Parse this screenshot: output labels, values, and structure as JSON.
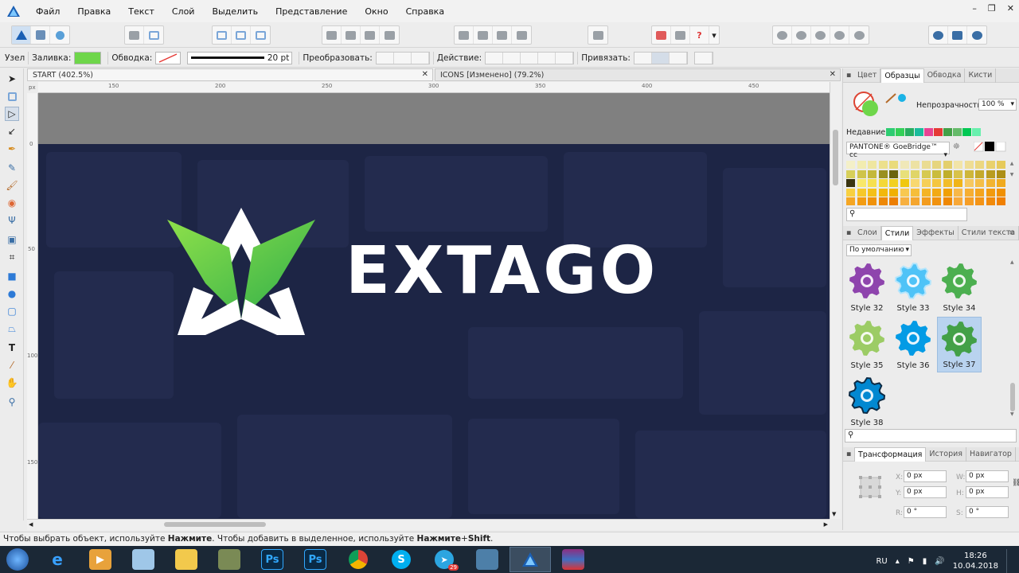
{
  "menu": {
    "items": [
      "Файл",
      "Правка",
      "Текст",
      "Слой",
      "Выделить",
      "Представление",
      "Окно",
      "Справка"
    ]
  },
  "context_bar": {
    "mode_label": "Узел",
    "fill_label": "Заливка:",
    "fill_color": "#6ed64a",
    "stroke_label": "Обводка:",
    "stroke_width": "20 pt",
    "transform_label": "Преобразовать:",
    "action_label": "Действие:",
    "snap_label": "Привязать:"
  },
  "tabs": [
    {
      "label": "START (402.5%)"
    },
    {
      "label": "ICONS [Изменено] (79.2%)"
    }
  ],
  "ruler": {
    "h_ticks": [
      "150",
      "200",
      "250",
      "300",
      "350",
      "400",
      "450"
    ],
    "v_ticks": [
      "0",
      "50",
      "100",
      "150"
    ],
    "unit": "px"
  },
  "canvas": {
    "brand_text": "EXTAGO",
    "background": "#1d2545"
  },
  "panel_top": {
    "tabs": [
      "Цвет",
      "Образцы",
      "Обводка",
      "Кисти"
    ],
    "active_tab": "Образцы",
    "opacity_label": "Непрозрачность:",
    "opacity_value": "100 %",
    "recent_label": "Недавние:",
    "recent_colors": [
      "#2ecc71",
      "#34d058",
      "#27ae60",
      "#1abc9c",
      "#e84393",
      "#e53935",
      "#43a047",
      "#66bb6a",
      "#00c853",
      "#69f0ae"
    ],
    "palette_name": "PANTONE® GoeBridge™ cc"
  },
  "panel_styles": {
    "tabs": [
      "Слои",
      "Стили",
      "Эффекты",
      "Стили текста"
    ],
    "active_tab": "Стили",
    "category": "По умолчанию",
    "items": [
      {
        "label": "Style 32",
        "color": "#8e44ad"
      },
      {
        "label": "Style 33",
        "color": "#4fc3f7"
      },
      {
        "label": "Style 34",
        "color": "#4caf50"
      },
      {
        "label": "Style 35",
        "color": "#9ccc65"
      },
      {
        "label": "Style 36",
        "color": "#039be5"
      },
      {
        "label": "Style 37",
        "color": "#43a047"
      },
      {
        "label": "Style 38",
        "color": "#0288d1"
      }
    ],
    "selected": "Style 37"
  },
  "panel_transform": {
    "tabs": [
      "Трансформация",
      "История",
      "Навигатор"
    ],
    "active_tab": "Трансформация",
    "x_label": "X:",
    "x_value": "0 px",
    "y_label": "Y:",
    "y_value": "0 px",
    "w_label": "W:",
    "w_value": "0 px",
    "h_label": "H:",
    "h_value": "0 px",
    "r_label": "R:",
    "r_value": "0 °",
    "s_label": "S:",
    "s_value": "0 °"
  },
  "status": {
    "text_a": "Чтобы выбрать объект, используйте ",
    "bold_a": "Нажмите",
    "text_b": ". Чтобы добавить в выделенное, используйте ",
    "bold_b": "Нажмите",
    "text_c": "+",
    "bold_c": "Shift",
    "text_d": "."
  },
  "taskbar": {
    "lang": "RU",
    "time": "18:26",
    "date": "10.04.2018",
    "telegram_badge": "29"
  }
}
